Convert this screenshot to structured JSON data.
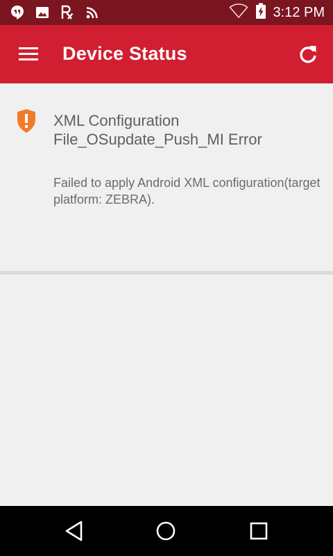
{
  "status_bar": {
    "time": "3:12 PM",
    "icons": [
      "hangouts-icon",
      "image-icon",
      "prescription-icon",
      "rss-icon",
      "wifi-icon",
      "battery-charging-icon"
    ]
  },
  "app_bar": {
    "title": "Device Status",
    "menu_icon": "hamburger-menu-icon",
    "refresh_icon": "refresh-icon",
    "background": "#d11f31"
  },
  "status_item": {
    "icon": "warning-shield-icon",
    "icon_color": "#f07b2a",
    "title": "XML Configuration File_OSupdate_Push_MI Error",
    "message": "Failed to apply Android XML configuration(target platform: ZEBRA)."
  },
  "nav_bar": {
    "buttons": [
      "back-icon",
      "home-icon",
      "recents-icon"
    ]
  }
}
